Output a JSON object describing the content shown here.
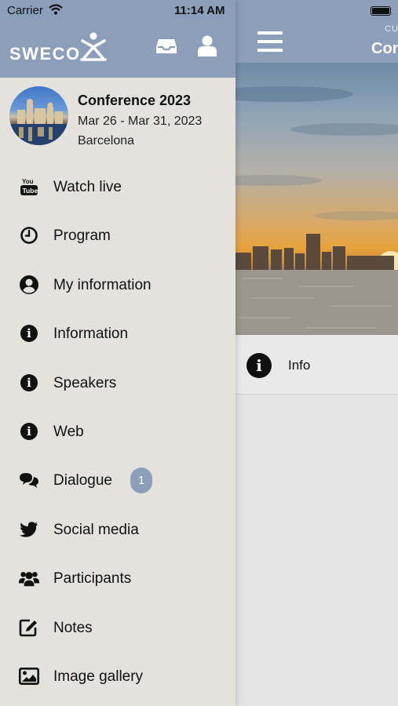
{
  "status_bar": {
    "carrier": "Carrier",
    "time": "11:14 AM"
  },
  "brand": {
    "logo_text": "SWECO",
    "header_color": "#8c9fba"
  },
  "main": {
    "subtitle": "CU",
    "title": "Con",
    "info_row_label": "Info"
  },
  "conference": {
    "title": "Conference 2023",
    "dates": "Mar 26 - Mar 31, 2023",
    "location": "Barcelona"
  },
  "menu": [
    {
      "label": "Watch live",
      "icon": "youtube-icon"
    },
    {
      "label": "Program",
      "icon": "clock-icon"
    },
    {
      "label": "My information",
      "icon": "user-circle-icon"
    },
    {
      "label": "Information",
      "icon": "info-icon"
    },
    {
      "label": "Speakers",
      "icon": "info-icon"
    },
    {
      "label": "Web",
      "icon": "info-icon"
    },
    {
      "label": "Dialogue",
      "icon": "chat-bubbles-icon",
      "badge": "1"
    },
    {
      "label": "Social media",
      "icon": "twitter-icon"
    },
    {
      "label": "Participants",
      "icon": "users-icon"
    },
    {
      "label": "Notes",
      "icon": "edit-note-icon"
    },
    {
      "label": "Image gallery",
      "icon": "image-icon"
    }
  ]
}
